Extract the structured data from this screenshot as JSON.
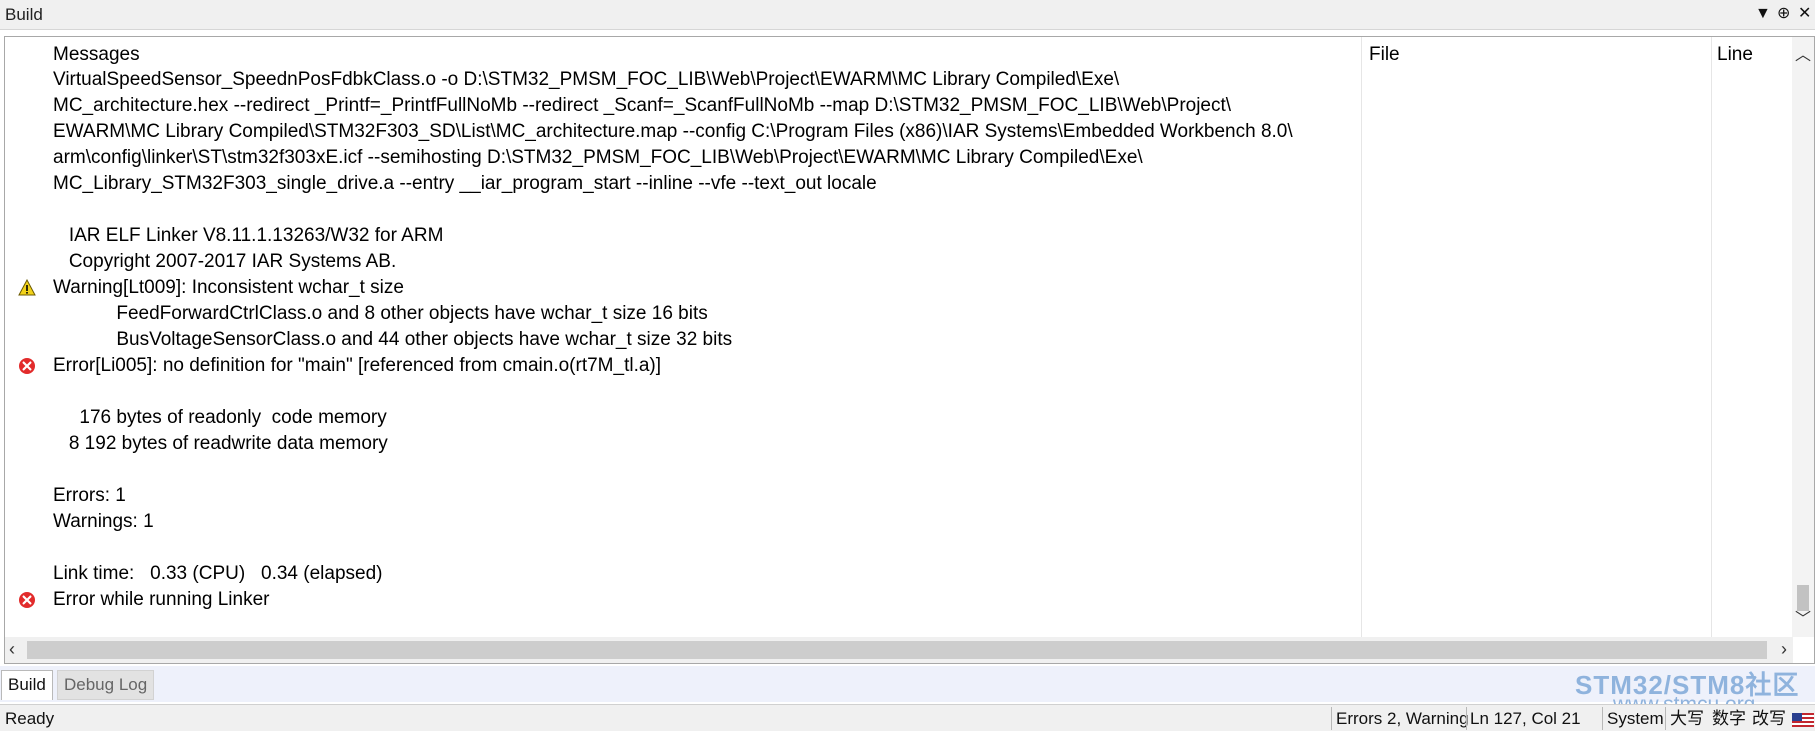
{
  "window": {
    "title": "Build",
    "controls": {
      "dropdown": "▼",
      "pin": "⊕",
      "close": "✕"
    }
  },
  "columns": {
    "messages": "Messages",
    "file": "File",
    "line": "Line"
  },
  "messages": [
    {
      "icon": "",
      "text": "VirtualSpeedSensor_SpeednPosFdbkClass.o -o D:\\STM32_PMSM_FOC_LIB\\Web\\Project\\EWARM\\MC Library Compiled\\Exe\\"
    },
    {
      "icon": "",
      "text": "MC_architecture.hex --redirect _Printf=_PrintfFullNoMb --redirect _Scanf=_ScanfFullNoMb --map D:\\STM32_PMSM_FOC_LIB\\Web\\Project\\"
    },
    {
      "icon": "",
      "text": "EWARM\\MC Library Compiled\\STM32F303_SD\\List\\MC_architecture.map --config C:\\Program Files (x86)\\IAR Systems\\Embedded Workbench 8.0\\"
    },
    {
      "icon": "",
      "text": "arm\\config\\linker\\ST\\stm32f303xE.icf --semihosting D:\\STM32_PMSM_FOC_LIB\\Web\\Project\\EWARM\\MC Library Compiled\\Exe\\"
    },
    {
      "icon": "",
      "text": "MC_Library_STM32F303_single_drive.a --entry __iar_program_start --inline --vfe --text_out locale"
    },
    {
      "icon": "",
      "text": ""
    },
    {
      "icon": "",
      "text": "   IAR ELF Linker V8.11.1.13263/W32 for ARM"
    },
    {
      "icon": "",
      "text": "   Copyright 2007-2017 IAR Systems AB."
    },
    {
      "icon": "warning",
      "text": "Warning[Lt009]: Inconsistent wchar_t size"
    },
    {
      "icon": "",
      "text": "            FeedForwardCtrlClass.o and 8 other objects have wchar_t size 16 bits"
    },
    {
      "icon": "",
      "text": "            BusVoltageSensorClass.o and 44 other objects have wchar_t size 32 bits"
    },
    {
      "icon": "error",
      "text": "Error[Li005]: no definition for \"main\" [referenced from cmain.o(rt7M_tl.a)]"
    },
    {
      "icon": "",
      "text": ""
    },
    {
      "icon": "",
      "text": "     176 bytes of readonly  code memory"
    },
    {
      "icon": "",
      "text": "   8 192 bytes of readwrite data memory"
    },
    {
      "icon": "",
      "text": ""
    },
    {
      "icon": "",
      "text": "Errors: 1"
    },
    {
      "icon": "",
      "text": "Warnings: 1"
    },
    {
      "icon": "",
      "text": ""
    },
    {
      "icon": "",
      "text": "Link time:   0.33 (CPU)   0.34 (elapsed)"
    },
    {
      "icon": "error",
      "text": "Error while running Linker"
    }
  ],
  "tabs": [
    {
      "label": "Build",
      "active": true
    },
    {
      "label": "Debug Log",
      "active": false
    }
  ],
  "watermark": {
    "brand": "STM32/STM8社区",
    "url": "www.stmcu.org"
  },
  "status": {
    "left": "Ready",
    "errors": "Errors 2, Warning",
    "position": "Ln 127, Col 21",
    "encoding": "System",
    "caps": "大写",
    "num": "数字",
    "ovr": "改写"
  },
  "colors": {
    "error": "#e22b2b",
    "warning": "#f2d21a",
    "tabbar": "#eef1fb"
  }
}
